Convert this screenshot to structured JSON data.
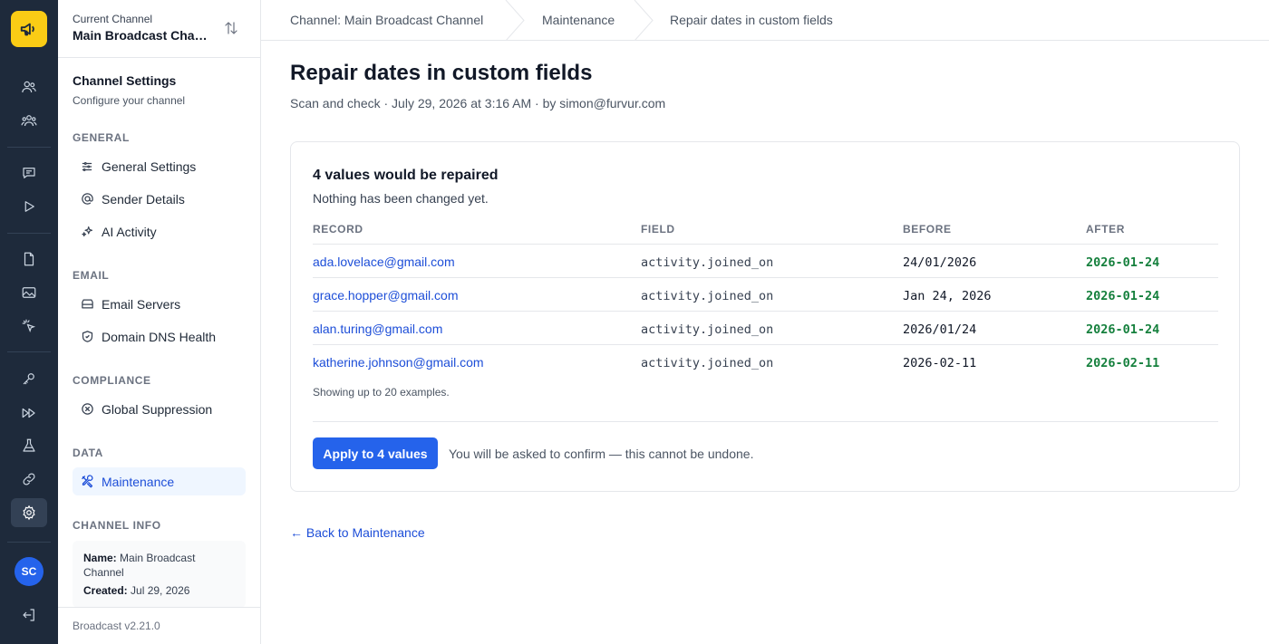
{
  "rail": {
    "logo_icon": "megaphone-icon",
    "items": [
      {
        "icon": "users-icon"
      },
      {
        "icon": "groups-icon"
      },
      {
        "icon": "chat-icon"
      },
      {
        "icon": "play-icon"
      },
      {
        "icon": "document-icon"
      },
      {
        "icon": "image-icon"
      },
      {
        "icon": "cursor-click-icon"
      },
      {
        "icon": "key-icon"
      },
      {
        "icon": "fast-forward-icon"
      },
      {
        "icon": "flask-icon"
      },
      {
        "icon": "link-icon"
      },
      {
        "icon": "gear-icon",
        "active": true
      }
    ],
    "avatar_initials": "SC",
    "logout_icon": "logout-icon"
  },
  "sidebar": {
    "current_label": "Current Channel",
    "current_name": "Main Broadcast Channel",
    "title": "Channel Settings",
    "subtitle": "Configure your channel",
    "sections": {
      "general": "GENERAL",
      "email": "EMAIL",
      "compliance": "COMPLIANCE",
      "data": "DATA",
      "channel_info": "CHANNEL INFO"
    },
    "items": {
      "general_settings": "General Settings",
      "sender_details": "Sender Details",
      "ai_activity": "AI Activity",
      "email_servers": "Email Servers",
      "domain_dns": "Domain DNS Health",
      "global_suppression": "Global Suppression",
      "maintenance": "Maintenance"
    },
    "info": {
      "name_label": "Name:",
      "name_value": "Main Broadcast Channel",
      "created_label": "Created:",
      "created_value": "Jul 29, 2026"
    },
    "version": "Broadcast v2.21.0"
  },
  "breadcrumb": [
    "Channel: Main Broadcast Channel",
    "Maintenance",
    "Repair dates in custom fields"
  ],
  "page": {
    "title": "Repair dates in custom fields",
    "meta": "Scan and check · July 29, 2026 at 3:16 AM · by simon@furvur.com"
  },
  "card": {
    "title": "4 values would be repaired",
    "subtitle": "Nothing has been changed yet.",
    "columns": [
      "RECORD",
      "FIELD",
      "BEFORE",
      "AFTER"
    ],
    "rows": [
      {
        "record": "ada.lovelace@gmail.com",
        "field": "activity.joined_on",
        "before": "24/01/2026",
        "after": "2026-01-24"
      },
      {
        "record": "grace.hopper@gmail.com",
        "field": "activity.joined_on",
        "before": "Jan 24, 2026",
        "after": "2026-01-24"
      },
      {
        "record": "alan.turing@gmail.com",
        "field": "activity.joined_on",
        "before": "2026/01/24",
        "after": "2026-01-24"
      },
      {
        "record": "katherine.johnson@gmail.com",
        "field": "activity.joined_on",
        "before": "2026-02-11",
        "after": "2026-02-11"
      }
    ],
    "note": "Showing up to 20 examples.",
    "apply_label": "Apply to 4 values",
    "apply_note": "You will be asked to confirm — this cannot be undone."
  },
  "back_link": "← Back to Maintenance",
  "colors": {
    "rail_bg": "#1e2a3b",
    "logo_bg": "#facc15",
    "accent": "#2563eb",
    "after_green": "#15803d"
  }
}
